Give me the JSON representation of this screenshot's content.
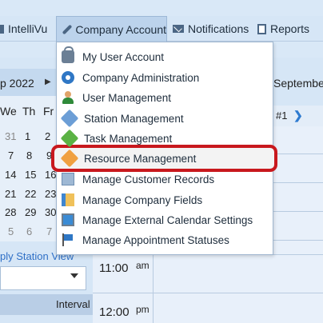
{
  "topnav": {
    "items": [
      {
        "label": "IntelliVu",
        "icon": "grid-icon"
      },
      {
        "label": "Company Account",
        "icon": "wrench-icon"
      },
      {
        "label": "Notifications",
        "icon": "envelope-icon"
      },
      {
        "label": "Reports",
        "icon": "report-icon"
      }
    ]
  },
  "calendar": {
    "month_label": "p 2022",
    "next_arrow": "▶",
    "weekdays": [
      "We",
      "Th",
      "Fr"
    ],
    "rows": [
      [
        "31",
        "1",
        "2"
      ],
      [
        "7",
        "8",
        "9"
      ],
      [
        "14",
        "15",
        "16"
      ],
      [
        "21",
        "22",
        "23"
      ],
      [
        "28",
        "29",
        "30"
      ],
      [
        "5",
        "6",
        "7"
      ]
    ],
    "apply_text": "ply Station View",
    "interval_label": "Interval"
  },
  "schedule": {
    "header_month": "September",
    "station_number": "#1",
    "station_arrow": "❯",
    "times": [
      {
        "time": "11:00",
        "ampm": "am"
      },
      {
        "time": "12:00",
        "ampm": "pm"
      }
    ]
  },
  "dropdown": {
    "items": [
      {
        "label": "My User Account",
        "icon": "lock-icon"
      },
      {
        "label": "Company Administration",
        "icon": "gear-icon"
      },
      {
        "label": "User Management",
        "icon": "user-icon"
      },
      {
        "label": "Station Management",
        "icon": "tag-blue-icon"
      },
      {
        "label": "Task Management",
        "icon": "tag-green-icon"
      },
      {
        "label": "Resource Management",
        "icon": "tag-orange-icon",
        "highlighted": true
      },
      {
        "label": "Manage Customer Records",
        "icon": "records-icon"
      },
      {
        "label": "Manage Company Fields",
        "icon": "fields-icon"
      },
      {
        "label": "Manage External Calendar Settings",
        "icon": "monitor-icon"
      },
      {
        "label": "Manage Appointment Statuses",
        "icon": "flag-icon"
      }
    ],
    "highlight_color": "#c8181d"
  }
}
